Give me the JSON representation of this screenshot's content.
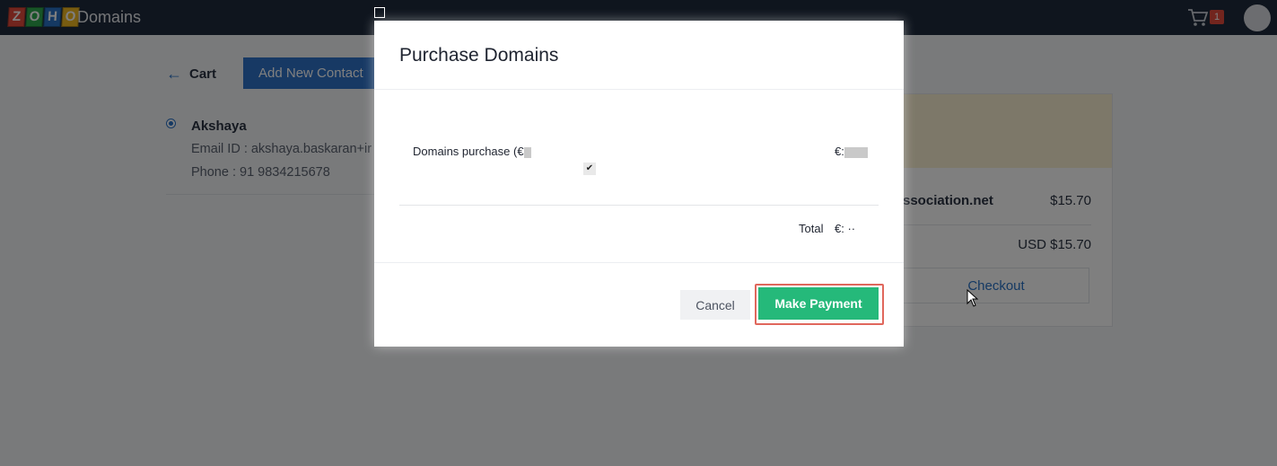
{
  "header": {
    "logo_letters": [
      "Z",
      "O",
      "H",
      "O"
    ],
    "app_title": "Domains",
    "cart_icon": "cart-icon",
    "cart_count": "1"
  },
  "page": {
    "back_label": "Cart",
    "add_contact_label": "Add New Contact",
    "contact": {
      "name": "Akshaya",
      "email": "Email ID : akshaya.baskaran+ir",
      "phone": "Phone : 91 9834215678"
    },
    "summary": {
      "domain_name": "ssociation.net",
      "domain_price": "$15.70",
      "total": "USD $15.70",
      "checkout_label": "Checkout"
    }
  },
  "modal": {
    "title": "Purchase Domains",
    "line_item_label": "Domains purchase (€",
    "line_item_amount": "€:",
    "total_label": "Total",
    "total_value": "€: ··",
    "cancel_label": "Cancel",
    "pay_label": "Make Payment"
  },
  "colors": {
    "topbar": "#1f2a3c",
    "primary_blue": "#2f72c8",
    "pay_green": "#25b97a",
    "highlight_red": "#e0675c"
  }
}
